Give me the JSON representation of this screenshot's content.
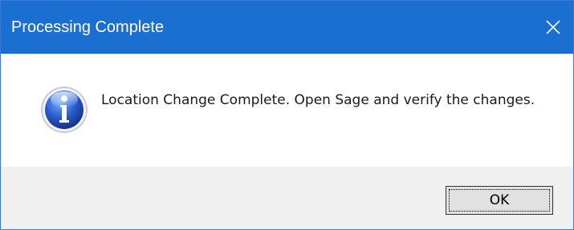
{
  "window": {
    "title": "Processing Complete",
    "title_bar_color": "#1a6fd1",
    "close_icon": "close-icon"
  },
  "dialog": {
    "icon": "info-icon",
    "message": "Location Change Complete. Open Sage and verify the changes."
  },
  "buttons": {
    "ok_label": "OK"
  }
}
